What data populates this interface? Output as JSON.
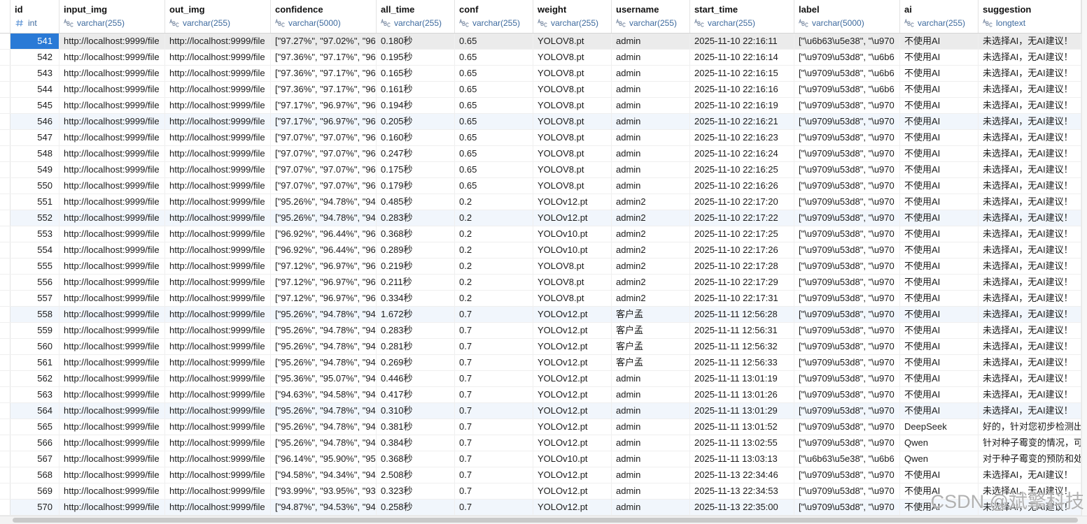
{
  "colors": {
    "selection": "#2a7ad6",
    "selected_row": "#ebebeb",
    "type_label": "#3d6a9e",
    "int_icon": "#5b93d6",
    "tinted_row": "#f1f6fc"
  },
  "grid": {
    "columns": [
      {
        "name": "id",
        "type": "int",
        "type_icon": "int-type-icon"
      },
      {
        "name": "input_img",
        "type": "varchar(255)",
        "type_icon": "varchar-type-icon"
      },
      {
        "name": "out_img",
        "type": "varchar(255)",
        "type_icon": "varchar-type-icon"
      },
      {
        "name": "confidence",
        "type": "varchar(5000)",
        "type_icon": "varchar-type-icon"
      },
      {
        "name": "all_time",
        "type": "varchar(255)",
        "type_icon": "varchar-type-icon"
      },
      {
        "name": "conf",
        "type": "varchar(255)",
        "type_icon": "varchar-type-icon"
      },
      {
        "name": "weight",
        "type": "varchar(255)",
        "type_icon": "varchar-type-icon"
      },
      {
        "name": "username",
        "type": "varchar(255)",
        "type_icon": "varchar-type-icon"
      },
      {
        "name": "start_time",
        "type": "varchar(255)",
        "type_icon": "varchar-type-icon"
      },
      {
        "name": "label",
        "type": "varchar(5000)",
        "type_icon": "varchar-type-icon"
      },
      {
        "name": "ai",
        "type": "varchar(255)",
        "type_icon": "varchar-type-icon"
      },
      {
        "name": "suggestion",
        "type": "longtext",
        "type_icon": "varchar-type-icon"
      }
    ],
    "rows": [
      {
        "selected": true,
        "cells": [
          "541",
          "http://localhost:9999/file",
          "http://localhost:9999/file",
          "[\"97.27%\", \"97.02%\", \"96",
          "0.180秒",
          "0.65",
          "YOLOV8.pt",
          "admin",
          "2025-11-10 22:16:11",
          "[\"\\u6b63\\u5e38\", \"\\u970",
          "不使用AI",
          "未选择AI，无AI建议！"
        ]
      },
      {
        "cells": [
          "542",
          "http://localhost:9999/file",
          "http://localhost:9999/file",
          "[\"97.36%\", \"97.17%\", \"96",
          "0.195秒",
          "0.65",
          "YOLOV8.pt",
          "admin",
          "2025-11-10 22:16:14",
          "[\"\\u9709\\u53d8\", \"\\u6b6",
          "不使用AI",
          "未选择AI，无AI建议！"
        ]
      },
      {
        "cells": [
          "543",
          "http://localhost:9999/file",
          "http://localhost:9999/file",
          "[\"97.36%\", \"97.17%\", \"96",
          "0.165秒",
          "0.65",
          "YOLOV8.pt",
          "admin",
          "2025-11-10 22:16:15",
          "[\"\\u9709\\u53d8\", \"\\u6b6",
          "不使用AI",
          "未选择AI，无AI建议！"
        ]
      },
      {
        "cells": [
          "544",
          "http://localhost:9999/file",
          "http://localhost:9999/file",
          "[\"97.36%\", \"97.17%\", \"96",
          "0.161秒",
          "0.65",
          "YOLOV8.pt",
          "admin",
          "2025-11-10 22:16:16",
          "[\"\\u9709\\u53d8\", \"\\u6b6",
          "不使用AI",
          "未选择AI，无AI建议！"
        ]
      },
      {
        "cells": [
          "545",
          "http://localhost:9999/file",
          "http://localhost:9999/file",
          "[\"97.17%\", \"96.97%\", \"96",
          "0.194秒",
          "0.65",
          "YOLOV8.pt",
          "admin",
          "2025-11-10 22:16:19",
          "[\"\\u9709\\u53d8\", \"\\u970",
          "不使用AI",
          "未选择AI，无AI建议！"
        ]
      },
      {
        "cells": [
          "546",
          "http://localhost:9999/file",
          "http://localhost:9999/file",
          "[\"97.17%\", \"96.97%\", \"96",
          "0.205秒",
          "0.65",
          "YOLOV8.pt",
          "admin",
          "2025-11-10 22:16:21",
          "[\"\\u9709\\u53d8\", \"\\u970",
          "不使用AI",
          "未选择AI，无AI建议！"
        ]
      },
      {
        "cells": [
          "547",
          "http://localhost:9999/file",
          "http://localhost:9999/file",
          "[\"97.07%\", \"97.07%\", \"96",
          "0.160秒",
          "0.65",
          "YOLOV8.pt",
          "admin",
          "2025-11-10 22:16:23",
          "[\"\\u9709\\u53d8\", \"\\u970",
          "不使用AI",
          "未选择AI，无AI建议！"
        ]
      },
      {
        "cells": [
          "548",
          "http://localhost:9999/file",
          "http://localhost:9999/file",
          "[\"97.07%\", \"97.07%\", \"96",
          "0.247秒",
          "0.65",
          "YOLOV8.pt",
          "admin",
          "2025-11-10 22:16:24",
          "[\"\\u9709\\u53d8\", \"\\u970",
          "不使用AI",
          "未选择AI，无AI建议！"
        ]
      },
      {
        "cells": [
          "549",
          "http://localhost:9999/file",
          "http://localhost:9999/file",
          "[\"97.07%\", \"97.07%\", \"96",
          "0.175秒",
          "0.65",
          "YOLOV8.pt",
          "admin",
          "2025-11-10 22:16:25",
          "[\"\\u9709\\u53d8\", \"\\u970",
          "不使用AI",
          "未选择AI，无AI建议！"
        ]
      },
      {
        "cells": [
          "550",
          "http://localhost:9999/file",
          "http://localhost:9999/file",
          "[\"97.07%\", \"97.07%\", \"96",
          "0.179秒",
          "0.65",
          "YOLOV8.pt",
          "admin",
          "2025-11-10 22:16:26",
          "[\"\\u9709\\u53d8\", \"\\u970",
          "不使用AI",
          "未选择AI，无AI建议！"
        ]
      },
      {
        "cells": [
          "551",
          "http://localhost:9999/file",
          "http://localhost:9999/file",
          "[\"95.26%\", \"94.78%\", \"94",
          "0.485秒",
          "0.2",
          "YOLOv12.pt",
          "admin2",
          "2025-11-10 22:17:20",
          "[\"\\u9709\\u53d8\", \"\\u970",
          "不使用AI",
          "未选择AI，无AI建议！"
        ]
      },
      {
        "cells": [
          "552",
          "http://localhost:9999/file",
          "http://localhost:9999/file",
          "[\"95.26%\", \"94.78%\", \"94",
          "0.283秒",
          "0.2",
          "YOLOv12.pt",
          "admin2",
          "2025-11-10 22:17:22",
          "[\"\\u9709\\u53d8\", \"\\u970",
          "不使用AI",
          "未选择AI，无AI建议！"
        ]
      },
      {
        "cells": [
          "553",
          "http://localhost:9999/file",
          "http://localhost:9999/file",
          "[\"96.92%\", \"96.44%\", \"96",
          "0.368秒",
          "0.2",
          "YOLOv10.pt",
          "admin2",
          "2025-11-10 22:17:25",
          "[\"\\u9709\\u53d8\", \"\\u970",
          "不使用AI",
          "未选择AI，无AI建议！"
        ]
      },
      {
        "cells": [
          "554",
          "http://localhost:9999/file",
          "http://localhost:9999/file",
          "[\"96.92%\", \"96.44%\", \"96",
          "0.289秒",
          "0.2",
          "YOLOv10.pt",
          "admin2",
          "2025-11-10 22:17:26",
          "[\"\\u9709\\u53d8\", \"\\u970",
          "不使用AI",
          "未选择AI，无AI建议！"
        ]
      },
      {
        "cells": [
          "555",
          "http://localhost:9999/file",
          "http://localhost:9999/file",
          "[\"97.12%\", \"96.97%\", \"96",
          "0.219秒",
          "0.2",
          "YOLOV8.pt",
          "admin2",
          "2025-11-10 22:17:28",
          "[\"\\u9709\\u53d8\", \"\\u970",
          "不使用AI",
          "未选择AI，无AI建议！"
        ]
      },
      {
        "cells": [
          "556",
          "http://localhost:9999/file",
          "http://localhost:9999/file",
          "[\"97.12%\", \"96.97%\", \"96",
          "0.211秒",
          "0.2",
          "YOLOV8.pt",
          "admin2",
          "2025-11-10 22:17:29",
          "[\"\\u9709\\u53d8\", \"\\u970",
          "不使用AI",
          "未选择AI，无AI建议！"
        ]
      },
      {
        "cells": [
          "557",
          "http://localhost:9999/file",
          "http://localhost:9999/file",
          "[\"97.12%\", \"96.97%\", \"96",
          "0.334秒",
          "0.2",
          "YOLOV8.pt",
          "admin2",
          "2025-11-10 22:17:31",
          "[\"\\u9709\\u53d8\", \"\\u970",
          "不使用AI",
          "未选择AI，无AI建议！"
        ]
      },
      {
        "cells": [
          "558",
          "http://localhost:9999/file",
          "http://localhost:9999/file",
          "[\"95.26%\", \"94.78%\", \"94",
          "1.672秒",
          "0.7",
          "YOLOv12.pt",
          "客户孟",
          "2025-11-11 12:56:28",
          "[\"\\u9709\\u53d8\", \"\\u970",
          "不使用AI",
          "未选择AI，无AI建议！"
        ]
      },
      {
        "cells": [
          "559",
          "http://localhost:9999/file",
          "http://localhost:9999/file",
          "[\"95.26%\", \"94.78%\", \"94",
          "0.283秒",
          "0.7",
          "YOLOv12.pt",
          "客户孟",
          "2025-11-11 12:56:31",
          "[\"\\u9709\\u53d8\", \"\\u970",
          "不使用AI",
          "未选择AI，无AI建议！"
        ]
      },
      {
        "cells": [
          "560",
          "http://localhost:9999/file",
          "http://localhost:9999/file",
          "[\"95.26%\", \"94.78%\", \"94",
          "0.281秒",
          "0.7",
          "YOLOv12.pt",
          "客户孟",
          "2025-11-11 12:56:32",
          "[\"\\u9709\\u53d8\", \"\\u970",
          "不使用AI",
          "未选择AI，无AI建议！"
        ]
      },
      {
        "cells": [
          "561",
          "http://localhost:9999/file",
          "http://localhost:9999/file",
          "[\"95.26%\", \"94.78%\", \"94",
          "0.269秒",
          "0.7",
          "YOLOv12.pt",
          "客户孟",
          "2025-11-11 12:56:33",
          "[\"\\u9709\\u53d8\", \"\\u970",
          "不使用AI",
          "未选择AI，无AI建议！"
        ]
      },
      {
        "cells": [
          "562",
          "http://localhost:9999/file",
          "http://localhost:9999/file",
          "[\"95.36%\", \"95.07%\", \"94",
          "0.446秒",
          "0.7",
          "YOLOv12.pt",
          "admin",
          "2025-11-11 13:01:19",
          "[\"\\u9709\\u53d8\", \"\\u970",
          "不使用AI",
          "未选择AI，无AI建议！"
        ]
      },
      {
        "cells": [
          "563",
          "http://localhost:9999/file",
          "http://localhost:9999/file",
          "[\"94.63%\", \"94.58%\", \"94",
          "0.417秒",
          "0.7",
          "YOLOv12.pt",
          "admin",
          "2025-11-11 13:01:26",
          "[\"\\u9709\\u53d8\", \"\\u970",
          "不使用AI",
          "未选择AI，无AI建议！"
        ]
      },
      {
        "cells": [
          "564",
          "http://localhost:9999/file",
          "http://localhost:9999/file",
          "[\"95.26%\", \"94.78%\", \"94",
          "0.310秒",
          "0.7",
          "YOLOv12.pt",
          "admin",
          "2025-11-11 13:01:29",
          "[\"\\u9709\\u53d8\", \"\\u970",
          "不使用AI",
          "未选择AI，无AI建议！"
        ]
      },
      {
        "cells": [
          "565",
          "http://localhost:9999/file",
          "http://localhost:9999/file",
          "[\"95.26%\", \"94.78%\", \"94",
          "0.381秒",
          "0.7",
          "YOLOv12.pt",
          "admin",
          "2025-11-11 13:01:52",
          "[\"\\u9709\\u53d8\", \"\\u970",
          "DeepSeek",
          "好的，针对您初步检测出的"
        ]
      },
      {
        "cells": [
          "566",
          "http://localhost:9999/file",
          "http://localhost:9999/file",
          "[\"95.26%\", \"94.78%\", \"94",
          "0.384秒",
          "0.7",
          "YOLOv12.pt",
          "admin",
          "2025-11-11 13:02:55",
          "[\"\\u9709\\u53d8\", \"\\u970",
          "Qwen",
          "针对种子霉变的情况，可以"
        ]
      },
      {
        "cells": [
          "567",
          "http://localhost:9999/file",
          "http://localhost:9999/file",
          "[\"96.14%\", \"95.90%\", \"95",
          "0.368秒",
          "0.7",
          "YOLOv10.pt",
          "admin",
          "2025-11-11 13:03:13",
          "[\"\\u6b63\\u5e38\", \"\\u6b6",
          "Qwen",
          "对于种子霉变的预防和处理"
        ]
      },
      {
        "cells": [
          "568",
          "http://localhost:9999/file",
          "http://localhost:9999/file",
          "[\"94.58%\", \"94.34%\", \"94",
          "2.508秒",
          "0.7",
          "YOLOv12.pt",
          "admin",
          "2025-11-13 22:34:46",
          "[\"\\u9709\\u53d8\", \"\\u970",
          "不使用AI",
          "未选择AI，无AI建议！"
        ]
      },
      {
        "cells": [
          "569",
          "http://localhost:9999/file",
          "http://localhost:9999/file",
          "[\"93.99%\", \"93.95%\", \"93",
          "0.323秒",
          "0.7",
          "YOLOv12.pt",
          "admin",
          "2025-11-13 22:34:53",
          "[\"\\u9709\\u53d8\", \"\\u970",
          "不使用AI",
          "未选择AI，无AI建议！"
        ]
      },
      {
        "cells": [
          "570",
          "http://localhost:9999/file",
          "http://localhost:9999/file",
          "[\"94.87%\", \"94.53%\", \"94",
          "0.258秒",
          "0.7",
          "YOLOv12.pt",
          "admin",
          "2025-11-13 22:35:00",
          "[\"\\u9709\\u53d8\", \"\\u970",
          "不使用AI",
          "未选择AI，无AI建议！"
        ]
      }
    ]
  },
  "watermark": "CSDN @斌擎科技"
}
